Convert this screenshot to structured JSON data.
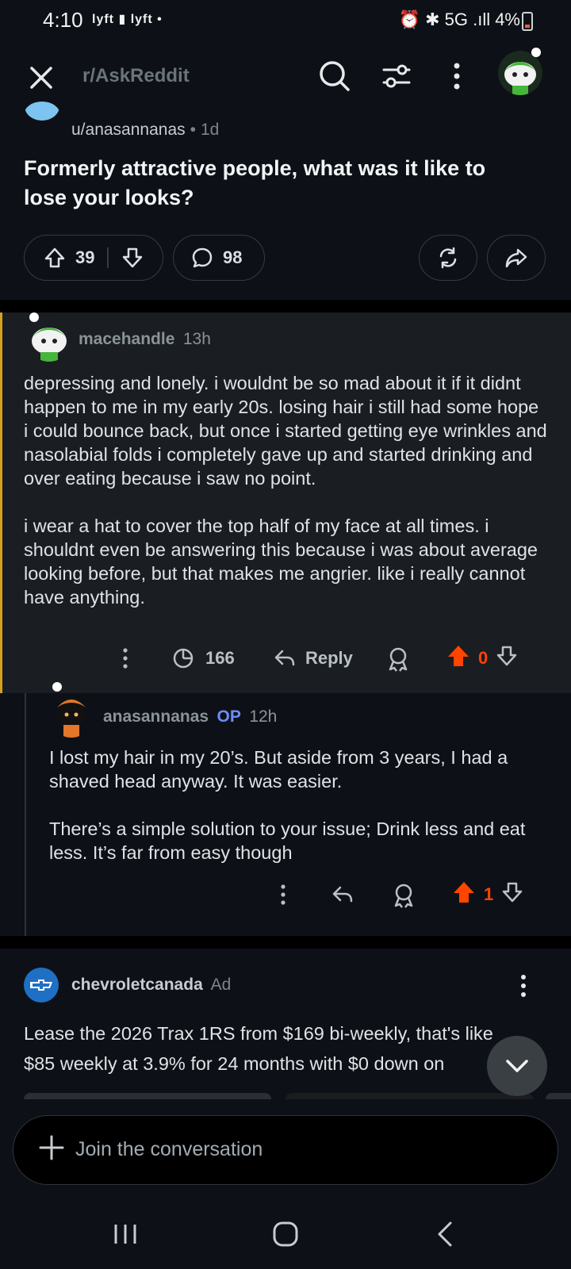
{
  "status_bar": {
    "time": "4:10",
    "left_icons": "lyft ▮ lyft •",
    "right_text": "⏰ ✱ 5G .ıll 4%",
    "battery_level": 0.04
  },
  "header": {
    "subreddit": "r/AskReddit"
  },
  "post": {
    "author": "u/anasannanas",
    "separator": "•",
    "age": "1d",
    "title": "Formerly attractive people, what was it like to lose your looks?",
    "upvotes": "39",
    "comments": "98"
  },
  "comments": [
    {
      "user": "macehandle",
      "age": "13h",
      "body": [
        "depressing and lonely. i wouldnt be so mad about it if it didnt happen to me in my early 20s. losing hair i still had some hope i could bounce back, but once i started getting eye wrinkles and nasolabial folds i completely gave up and started drinking and over eating because i saw no point.",
        "i wear a hat to cover the top half of my face at all times. i shouldnt even be answering this because i was about average looking before, but that makes me angrier. like i really cannot have anything."
      ],
      "replies_count": "166",
      "reply_label": "Reply",
      "score": "0"
    },
    {
      "user": "anasannanas",
      "op_tag": "OP",
      "age": "12h",
      "body": [
        "I lost my hair in my 20’s. But aside from 3 years, I had a shaved head anyway. It was easier.",
        "There’s a simple solution to your issue; Drink less and eat less. It’s far from easy though"
      ],
      "score": "1"
    }
  ],
  "ad": {
    "advertiser": "chevroletcanada",
    "tag": "Ad",
    "text_line1": "Lease the 2026 Trax 1RS from $169 bi-weekly, that's like",
    "text_line2": "$85 weekly at 3.9% for 24 months with $0 down on"
  },
  "composer": {
    "placeholder": "Join the conversation"
  },
  "colors": {
    "background": "#0d1117",
    "comment_highlight": "#1a1d21",
    "accent_border": "#d4a21f",
    "upvote_orange": "#ff4500",
    "op_blue": "#6c8df5"
  }
}
